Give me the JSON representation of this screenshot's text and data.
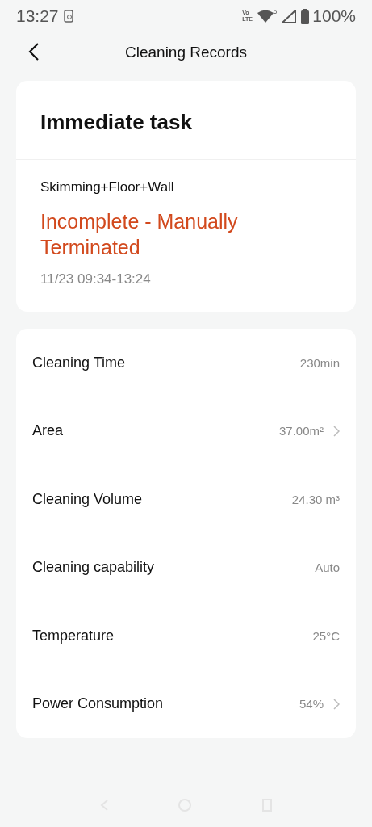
{
  "status_bar": {
    "time": "13:27",
    "network_top": "Vo",
    "network_bottom": "LTE",
    "wifi_badge": "6",
    "battery": "100%"
  },
  "header": {
    "title": "Cleaning Records"
  },
  "task": {
    "title": "Immediate task",
    "mode": "Skimming+Floor+Wall",
    "status": "Incomplete - Manually Terminated",
    "time_range": "11/23 09:34-13:24"
  },
  "details": [
    {
      "label": "Cleaning Time",
      "value": "230min",
      "chevron": false
    },
    {
      "label": "Area",
      "value": "37.00m²",
      "chevron": true
    },
    {
      "label": "Cleaning Volume",
      "value": "24.30 m³",
      "chevron": false
    },
    {
      "label": "Cleaning capability",
      "value": "Auto",
      "chevron": false
    },
    {
      "label": "Temperature",
      "value": "25°C",
      "chevron": false
    },
    {
      "label": "Power Consumption",
      "value": "54%",
      "chevron": true
    }
  ]
}
